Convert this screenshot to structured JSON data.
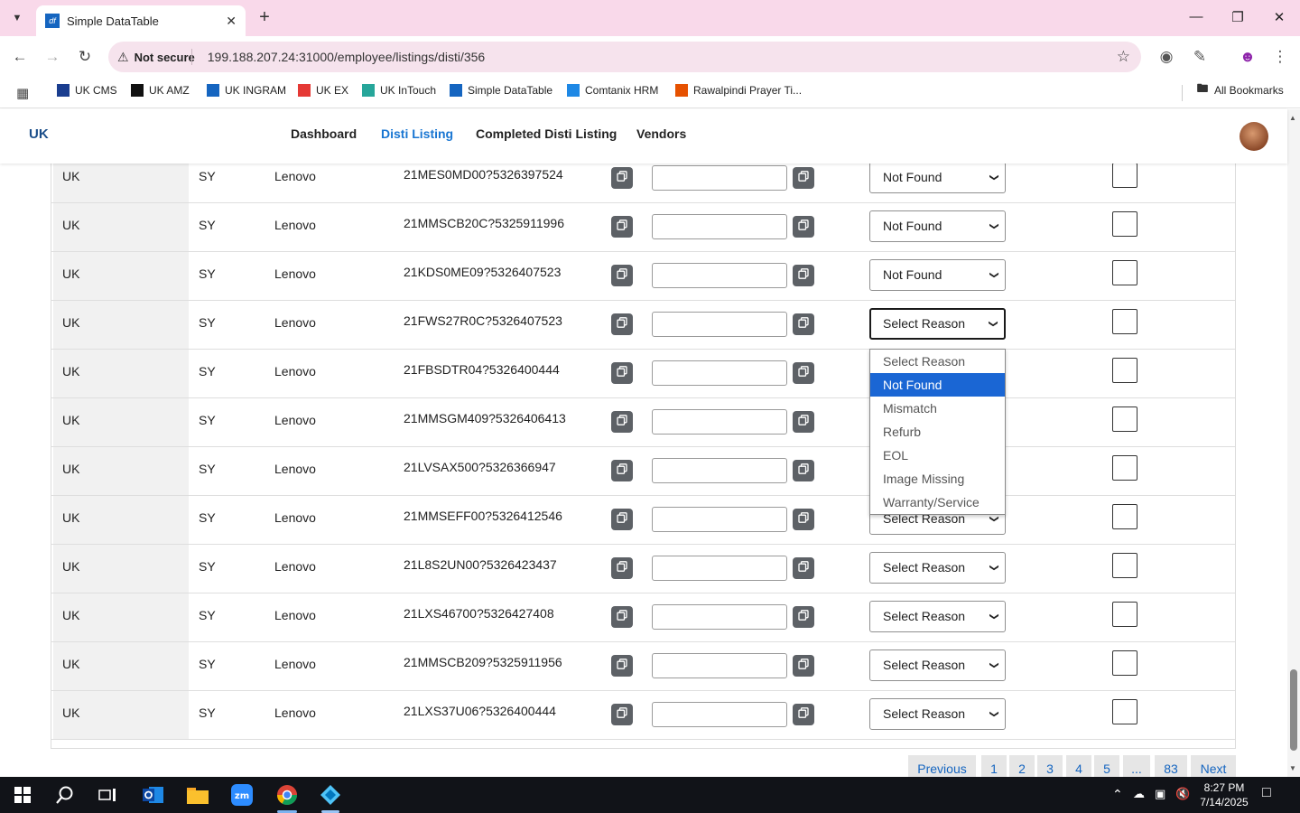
{
  "browser": {
    "tab_title": "Simple DataTable",
    "tab_favicon": "df",
    "security_label": "Not secure",
    "url": "199.188.207.24:31000/employee/listings/disti/356",
    "bookmarks": [
      {
        "label": "UK CMS",
        "color": "#1a3d8f",
        "glyph": "uk"
      },
      {
        "label": "UK AMZ",
        "color": "#111111",
        "glyph": "a"
      },
      {
        "label": "UK INGRAM",
        "color": "#1565c0",
        "glyph": "i"
      },
      {
        "label": "UK EX",
        "color": "#e53935",
        "glyph": "ex"
      },
      {
        "label": "UK InTouch",
        "color": "#26a69a",
        "glyph": "c"
      },
      {
        "label": "Simple DataTable",
        "color": "#1565c0",
        "glyph": "df"
      },
      {
        "label": "Comtanix HRM",
        "color": "#1e88e5",
        "glyph": "c"
      },
      {
        "label": "Rawalpindi Prayer Ti...",
        "color": "#e65100",
        "glyph": "r"
      }
    ],
    "all_bookmarks": "All Bookmarks"
  },
  "nav": {
    "logo": "UK",
    "links": [
      "Dashboard",
      "Disti Listing",
      "Completed Disti Listing",
      "Vendors"
    ],
    "active": "Disti Listing"
  },
  "rows": [
    {
      "region": "UK",
      "code": "SY",
      "brand": "Lenovo",
      "sku": "21MES0MD00?5326397524",
      "reason": "Not Found"
    },
    {
      "region": "UK",
      "code": "SY",
      "brand": "Lenovo",
      "sku": "21MMSCB20C?5325911996",
      "reason": "Not Found"
    },
    {
      "region": "UK",
      "code": "SY",
      "brand": "Lenovo",
      "sku": "21KDS0ME09?5326407523",
      "reason": "Not Found"
    },
    {
      "region": "UK",
      "code": "SY",
      "brand": "Lenovo",
      "sku": "21FWS27R0C?5326407523",
      "reason": "Select Reason"
    },
    {
      "region": "UK",
      "code": "SY",
      "brand": "Lenovo",
      "sku": "21FBSDTR04?5326400444",
      "reason": "Select Reason"
    },
    {
      "region": "UK",
      "code": "SY",
      "brand": "Lenovo",
      "sku": "21MMSGM409?5326406413",
      "reason": "Select Reason"
    },
    {
      "region": "UK",
      "code": "SY",
      "brand": "Lenovo",
      "sku": "21LVSAX500?5326366947",
      "reason": "Select Reason"
    },
    {
      "region": "UK",
      "code": "SY",
      "brand": "Lenovo",
      "sku": "21MMSEFF00?5326412546",
      "reason": "Select Reason"
    },
    {
      "region": "UK",
      "code": "SY",
      "brand": "Lenovo",
      "sku": "21L8S2UN00?5326423437",
      "reason": "Select Reason"
    },
    {
      "region": "UK",
      "code": "SY",
      "brand": "Lenovo",
      "sku": "21LXS46700?5326427408",
      "reason": "Select Reason"
    },
    {
      "region": "UK",
      "code": "SY",
      "brand": "Lenovo",
      "sku": "21MMSCB209?5325911956",
      "reason": "Select Reason"
    },
    {
      "region": "UK",
      "code": "SY",
      "brand": "Lenovo",
      "sku": "21LXS37U06?5326400444",
      "reason": "Select Reason"
    }
  ],
  "dropdown": {
    "options": [
      "Select Reason",
      "Not Found",
      "Mismatch",
      "Refurb",
      "EOL",
      "Image Missing",
      "Warranty/Service"
    ],
    "highlighted": "Not Found"
  },
  "pagination": {
    "previous": "Previous",
    "pages": [
      "1",
      "2",
      "3",
      "4",
      "5",
      "...",
      "83"
    ],
    "next": "Next"
  },
  "taskbar": {
    "time": "8:27 PM",
    "date": "7/14/2025"
  }
}
